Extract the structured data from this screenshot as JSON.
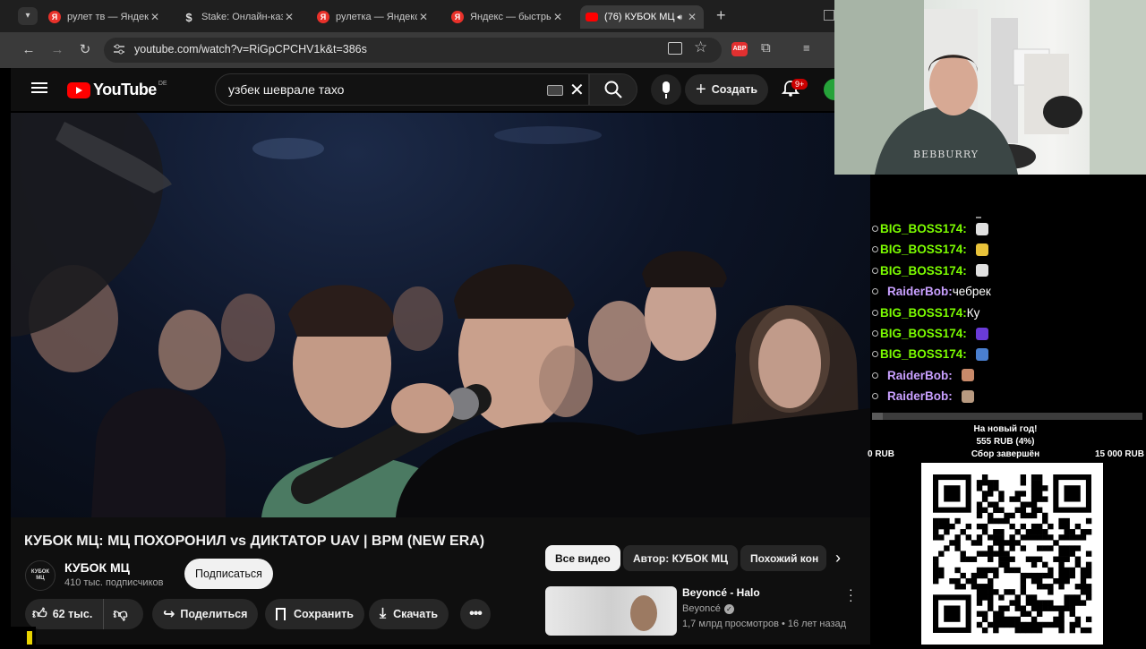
{
  "browser": {
    "tabs": [
      {
        "favicon": "yandex-icon",
        "label": "рулет тв — Яндекс",
        "active": false
      },
      {
        "favicon": "stake-icon",
        "label": "Stake: Онлайн-казино",
        "active": false
      },
      {
        "favicon": "yandex-icon",
        "label": "рулетка — Яндекс",
        "active": false
      },
      {
        "favicon": "yandex-icon",
        "label": "Яндекс — быстрый",
        "active": false
      },
      {
        "favicon": "youtube-icon",
        "label": "(76) КУБОК МЦ",
        "active": true
      }
    ],
    "new_tab_label": "+",
    "url": "youtube.com/watch?v=RiGpCPCHV1k&t=386s",
    "extension_badge": "ABP"
  },
  "youtube": {
    "logo_text": "YouTube",
    "region": "DE",
    "search_value": "узбек шевралe тахо",
    "create_label": "Создать",
    "notifications_badge": "9+",
    "video_title": "КУБОК МЦ: МЦ ПОХОРОНИЛ vs ДИКТАТОР UAV | BPM (NEW ERA)",
    "channel": {
      "name": "КУБОК МЦ",
      "subscribers": "410 тыс. подписчиков",
      "avatar_text": "КУБОК МЦ"
    },
    "subscribe_label": "Подписаться",
    "actions": {
      "likes": "62 тыс.",
      "share": "Поделиться",
      "save": "Сохранить",
      "download": "Скачать"
    },
    "chips": [
      "Все видео",
      "Автор: КУБОК МЦ",
      "Похожий кон"
    ],
    "recommendation": {
      "title": "Beyoncé - Halo",
      "channel": "Beyoncé",
      "meta": "1,7 млрд просмотров • 16 лет назад"
    }
  },
  "chat": [
    {
      "user": "BIG_BOSS174",
      "sep": ": ",
      "text": "",
      "color": "#7cfc00",
      "emote": "#e0e0e0"
    },
    {
      "user": "BIG_BOSS174",
      "sep": ": ",
      "text": "",
      "color": "#7cfc00",
      "emote": "#e8c23a"
    },
    {
      "user": "BIG_BOSS174",
      "sep": ": ",
      "text": "",
      "color": "#7cfc00",
      "emote": "#e0e0e0"
    },
    {
      "user": "RaiderBob",
      "sep": ":",
      "text": "чебрек",
      "color": "#c9a0ff",
      "emote": ""
    },
    {
      "user": "BIG_BOSS174",
      "sep": ":",
      "text": "Ку",
      "color": "#7cfc00",
      "emote": ""
    },
    {
      "user": "BIG_BOSS174",
      "sep": ": ",
      "text": "",
      "color": "#7cfc00",
      "emote": "#6a3bd8"
    },
    {
      "user": "BIG_BOSS174",
      "sep": ": ",
      "text": "",
      "color": "#7cfc00",
      "emote": "#4a7fd0"
    },
    {
      "user": "RaiderBob",
      "sep": ": ",
      "text": "",
      "color": "#c9a0ff",
      "emote": "#c98a6a"
    },
    {
      "user": "RaiderBob",
      "sep": ": ",
      "text": "",
      "color": "#c9a0ff",
      "emote": "#b89a80"
    }
  ],
  "donation": {
    "goal_title": "На новый год!",
    "raised": "555 RUB (4%)",
    "progress": 0.04,
    "min": "0 RUB",
    "status": "Сбор завершён",
    "max": "15 000 RUB"
  },
  "webcam": {
    "shirt_text": "BEBBURRY"
  }
}
